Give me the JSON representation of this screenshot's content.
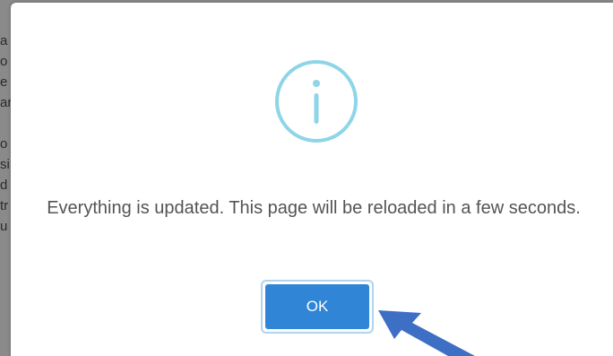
{
  "background_text_fragments": [
    "a",
    "o",
    "e",
    "ar",
    "o",
    "si",
    "d",
    "tr",
    "u"
  ],
  "dialog": {
    "icon": "info-icon",
    "message": "Everything is updated. This page will be reloaded in a few seconds.",
    "ok_label": "OK"
  },
  "colors": {
    "icon_stroke": "#8ed5e8",
    "button": "#3085d6",
    "button_focus_ring": "#aed4f0",
    "arrow": "#3d6fc4"
  }
}
